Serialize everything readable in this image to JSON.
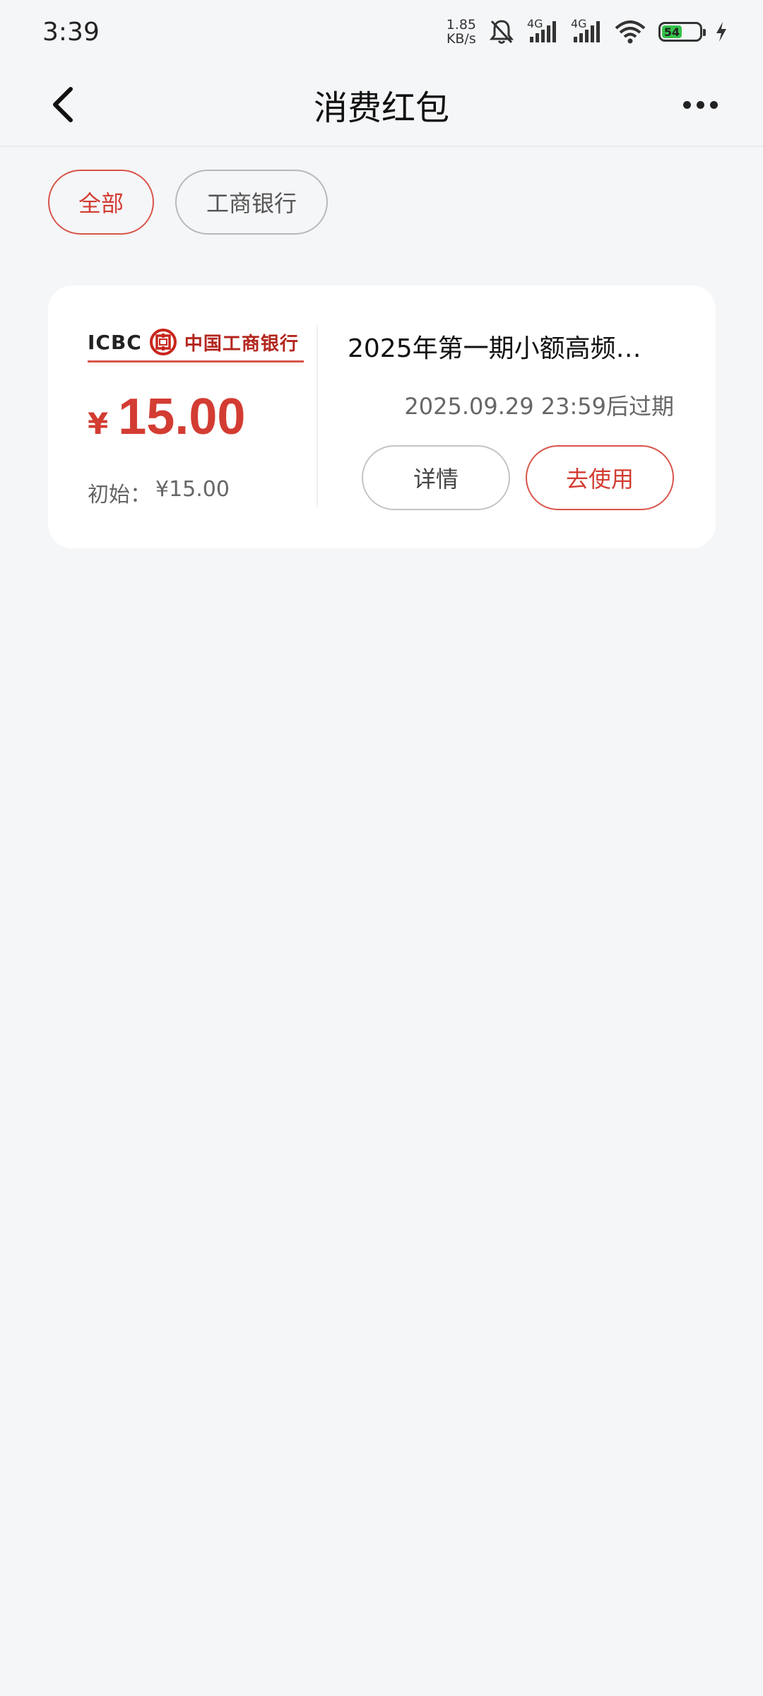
{
  "status_bar": {
    "time": "3:39",
    "net_speed_value": "1.85",
    "net_speed_unit": "KB/s",
    "signal_1_label": "4G",
    "signal_2_label": "4G",
    "battery_level": "54"
  },
  "nav": {
    "title": "消费红包"
  },
  "filters": {
    "all_label": "全部",
    "icbc_label": "工商银行"
  },
  "coupon": {
    "bank_en": "ICBC",
    "bank_cn": "中国工商银行",
    "currency": "¥",
    "amount": "15.00",
    "initial_label": "初始：",
    "initial_value": "¥15.00",
    "title": "2025年第一期小额高频…",
    "expiry": "2025.09.29 23:59后过期",
    "detail_button": "详情",
    "use_button": "去使用"
  },
  "colors": {
    "accent_red": "#d33c32",
    "background": "#f5f6f8",
    "card": "#ffffff"
  }
}
